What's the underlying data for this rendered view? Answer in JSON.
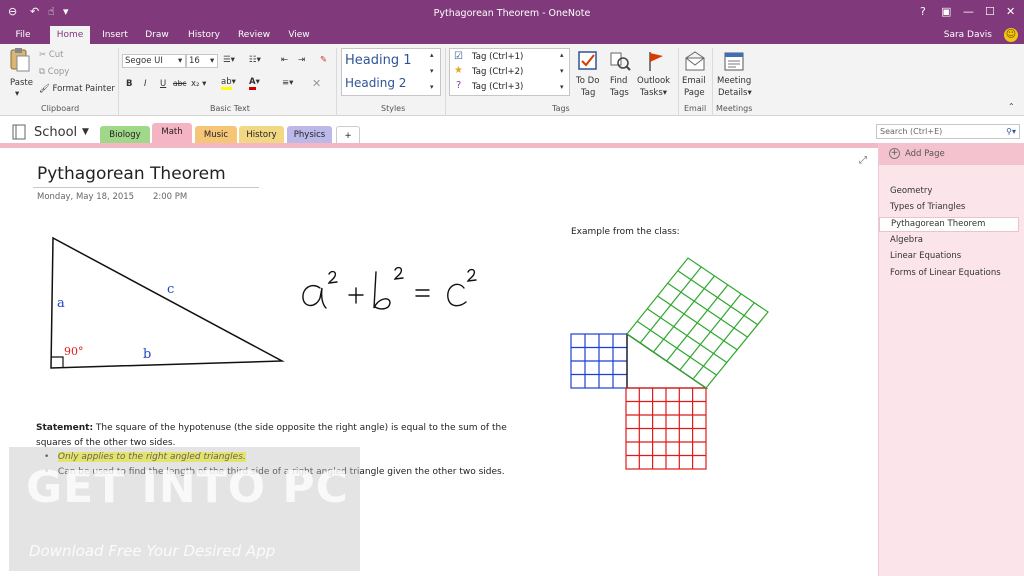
{
  "window": {
    "title": "Pythagorean Theorem - OneNote",
    "help": "?",
    "user": "Sara Davis"
  },
  "ribbon_tabs": [
    "File",
    "Home",
    "Insert",
    "Draw",
    "History",
    "Review",
    "View"
  ],
  "ribbon": {
    "clipboard": {
      "paste": "Paste",
      "cut": "Cut",
      "copy": "Copy",
      "format_painter": "Format Painter",
      "label": "Clipboard"
    },
    "basic_text": {
      "font": "Segoe UI",
      "size": "16",
      "bold": "B",
      "italic": "I",
      "underline": "U",
      "strike": "abc",
      "subscript": "x",
      "label": "Basic Text"
    },
    "styles": {
      "heading1": "Heading 1",
      "heading2": "Heading 2",
      "label": "Styles"
    },
    "tags": {
      "items": [
        "Tag (Ctrl+1)",
        "Tag (Ctrl+2)",
        "Tag (Ctrl+3)"
      ],
      "todo1": "To Do",
      "todo2": "Tag",
      "find1": "Find",
      "find2": "Tags",
      "outlook1": "Outlook",
      "outlook2": "Tasks",
      "label": "Tags"
    },
    "email": {
      "line1": "Email",
      "line2": "Page",
      "label": "Email"
    },
    "meetings": {
      "line1": "Meeting",
      "line2": "Details",
      "label": "Meetings"
    }
  },
  "notebook": {
    "name": "School"
  },
  "sections": [
    {
      "name": "Biology",
      "color": "#9fd889"
    },
    {
      "name": "Math",
      "color": "#f4b4c1"
    },
    {
      "name": "Music",
      "color": "#f5c578"
    },
    {
      "name": "History",
      "color": "#f2d884"
    },
    {
      "name": "Physics",
      "color": "#bcb8ea"
    },
    {
      "name": "+",
      "color": "#ffffff"
    }
  ],
  "search": {
    "placeholder": "Search (Ctrl+E)"
  },
  "pages": {
    "add_label": "Add Page",
    "items": [
      "Geometry",
      "Types of Triangles",
      "Pythagorean Theorem",
      "Algebra",
      "Linear Equations",
      "Forms of Linear Equations"
    ],
    "selected_index": 2
  },
  "note": {
    "title": "Pythagorean Theorem",
    "date": "Monday, May 18, 2015",
    "time": "2:00 PM",
    "example_label": "Example from the class:",
    "triangle_labels": {
      "a": "a",
      "b": "b",
      "c": "c",
      "angle": "90°"
    },
    "statement_bold": "Statement:",
    "statement": " The square of the hypotenuse (the side opposite the right angle) is equal to the sum of the squares of the other two sides.",
    "bullets": [
      "Only applies to the right angled triangles.",
      "Can be used to find the length of the third side of a right angled triangle given the other two sides."
    ]
  },
  "watermark": {
    "title": "GET INTO PC",
    "subtitle": "Download Free Your Desired App"
  }
}
